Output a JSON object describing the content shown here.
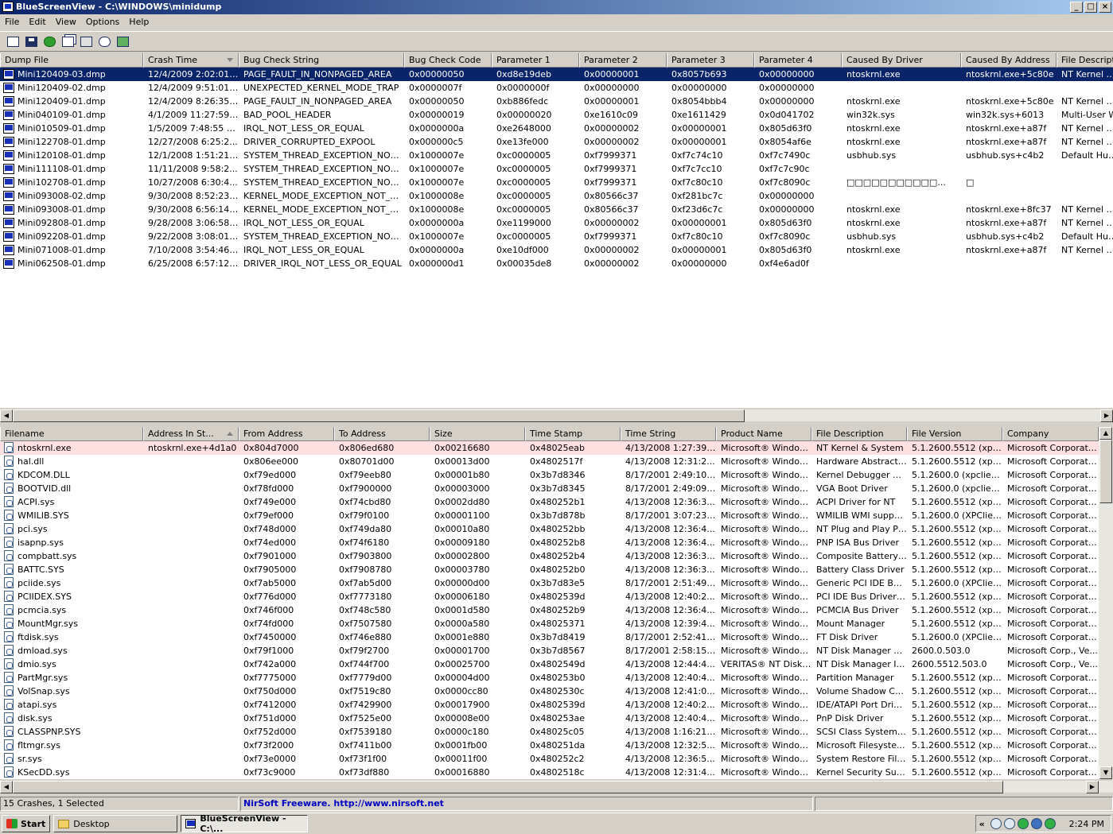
{
  "window": {
    "title": "BlueScreenView  -  C:\\WINDOWS\\minidump",
    "min": "_",
    "max": "□",
    "close": "×"
  },
  "menu": [
    "File",
    "Edit",
    "View",
    "Options",
    "Help"
  ],
  "toolbar": [
    "properties-list-icon",
    "save-icon",
    "refresh-icon",
    "copy-icon",
    "properties-icon",
    "find-icon",
    "exit-icon"
  ],
  "crash_table": {
    "columns": [
      "Dump File",
      "Crash Time",
      "Bug Check String",
      "Bug Check Code",
      "Parameter 1",
      "Parameter 2",
      "Parameter 3",
      "Parameter 4",
      "Caused By Driver",
      "Caused By Address",
      "File Descripti"
    ],
    "rows": [
      [
        "Mini120409-03.dmp",
        "12/4/2009 2:02:01 PM",
        "PAGE_FAULT_IN_NONPAGED_AREA",
        "0x00000050",
        "0xd8e19deb",
        "0x00000001",
        "0x8057b693",
        "0x00000000",
        "ntoskrnl.exe",
        "ntoskrnl.exe+5c80e",
        "NT Kernel & S"
      ],
      [
        "Mini120409-02.dmp",
        "12/4/2009 9:51:01 ...",
        "UNEXPECTED_KERNEL_MODE_TRAP",
        "0x0000007f",
        "0x0000000f",
        "0x00000000",
        "0x00000000",
        "0x00000000",
        "",
        "",
        ""
      ],
      [
        "Mini120409-01.dmp",
        "12/4/2009 8:26:35 ...",
        "PAGE_FAULT_IN_NONPAGED_AREA",
        "0x00000050",
        "0xb886fedc",
        "0x00000001",
        "0x8054bbb4",
        "0x00000000",
        "ntoskrnl.exe",
        "ntoskrnl.exe+5c80e",
        "NT Kernel & S"
      ],
      [
        "Mini040109-01.dmp",
        "4/1/2009 11:27:59 ...",
        "BAD_POOL_HEADER",
        "0x00000019",
        "0x00000020",
        "0xe1610c09",
        "0xe1611429",
        "0x0d041702",
        "win32k.sys",
        "win32k.sys+6013",
        "Multi-User W"
      ],
      [
        "Mini010509-01.dmp",
        "1/5/2009 7:48:55 AM",
        "IRQL_NOT_LESS_OR_EQUAL",
        "0x0000000a",
        "0xe2648000",
        "0x00000002",
        "0x00000001",
        "0x805d63f0",
        "ntoskrnl.exe",
        "ntoskrnl.exe+a87f",
        "NT Kernel & S"
      ],
      [
        "Mini122708-01.dmp",
        "12/27/2008 6:25:2...",
        "DRIVER_CORRUPTED_EXPOOL",
        "0x000000c5",
        "0xe13fe000",
        "0x00000002",
        "0x00000001",
        "0x8054af6e",
        "ntoskrnl.exe",
        "ntoskrnl.exe+a87f",
        "NT Kernel & S"
      ],
      [
        "Mini120108-01.dmp",
        "12/1/2008 1:51:21 PM",
        "SYSTEM_THREAD_EXCEPTION_NOT_...",
        "0x1000007e",
        "0xc0000005",
        "0xf7999371",
        "0xf7c74c10",
        "0xf7c7490c",
        "usbhub.sys",
        "usbhub.sys+c4b2",
        "Default Hub D"
      ],
      [
        "Mini111108-01.dmp",
        "11/11/2008 9:58:2...",
        "SYSTEM_THREAD_EXCEPTION_NOT_...",
        "0x1000007e",
        "0xc0000005",
        "0xf7999371",
        "0xf7c7cc10",
        "0xf7c7c90c",
        "",
        "",
        ""
      ],
      [
        "Mini102708-01.dmp",
        "10/27/2008 6:30:4...",
        "SYSTEM_THREAD_EXCEPTION_NOT_...",
        "0x1000007e",
        "0xc0000005",
        "0xf7999371",
        "0xf7c80c10",
        "0xf7c8090c",
        "□□□□□□□□□□□...",
        "□",
        ""
      ],
      [
        "Mini093008-02.dmp",
        "9/30/2008 8:52:23 ...",
        "KERNEL_MODE_EXCEPTION_NOT_HA...",
        "0x1000008e",
        "0xc0000005",
        "0x80566c37",
        "0xf281bc7c",
        "0x00000000",
        "",
        "",
        ""
      ],
      [
        "Mini093008-01.dmp",
        "9/30/2008 6:56:14 ...",
        "KERNEL_MODE_EXCEPTION_NOT_HA...",
        "0x1000008e",
        "0xc0000005",
        "0x80566c37",
        "0xf23d6c7c",
        "0x00000000",
        "ntoskrnl.exe",
        "ntoskrnl.exe+8fc37",
        "NT Kernel & S"
      ],
      [
        "Mini092808-01.dmp",
        "9/28/2008 3:06:58 PM",
        "IRQL_NOT_LESS_OR_EQUAL",
        "0x0000000a",
        "0xe1199000",
        "0x00000002",
        "0x00000001",
        "0x805d63f0",
        "ntoskrnl.exe",
        "ntoskrnl.exe+a87f",
        "NT Kernel & S"
      ],
      [
        "Mini092208-01.dmp",
        "9/22/2008 3:08:01 PM",
        "SYSTEM_THREAD_EXCEPTION_NOT_...",
        "0x1000007e",
        "0xc0000005",
        "0xf7999371",
        "0xf7c80c10",
        "0xf7c8090c",
        "usbhub.sys",
        "usbhub.sys+c4b2",
        "Default Hub D"
      ],
      [
        "Mini071008-01.dmp",
        "7/10/2008 3:54:46 PM",
        "IRQL_NOT_LESS_OR_EQUAL",
        "0x0000000a",
        "0xe10df000",
        "0x00000002",
        "0x00000001",
        "0x805d63f0",
        "ntoskrnl.exe",
        "ntoskrnl.exe+a87f",
        "NT Kernel & S"
      ],
      [
        "Mini062508-01.dmp",
        "6/25/2008 6:57:12 ...",
        "DRIVER_IRQL_NOT_LESS_OR_EQUAL",
        "0x000000d1",
        "0x00035de8",
        "0x00000002",
        "0x00000000",
        "0xf4e6ad0f",
        "",
        "",
        ""
      ]
    ]
  },
  "driver_table": {
    "columns": [
      "Filename",
      "Address In St...",
      "From Address",
      "To Address",
      "Size",
      "Time Stamp",
      "Time String",
      "Product Name",
      "File Description",
      "File Version",
      "Company"
    ],
    "rows": [
      [
        "ntoskrnl.exe",
        "ntoskrnl.exe+4d1a0",
        "0x804d7000",
        "0x806ed680",
        "0x00216680",
        "0x48025eab",
        "4/13/2008 1:27:39 PM",
        "Microsoft® Window...",
        "NT Kernel & System",
        "5.1.2600.5512 (xps...",
        "Microsoft Corporation"
      ],
      [
        "hal.dll",
        "",
        "0x806ee000",
        "0x80701d00",
        "0x00013d00",
        "0x4802517f",
        "4/13/2008 12:31:2...",
        "Microsoft® Window...",
        "Hardware Abstracti...",
        "5.1.2600.5512 (xps...",
        "Microsoft Corporation"
      ],
      [
        "KDCOM.DLL",
        "",
        "0xf79ed000",
        "0xf79eeb80",
        "0x00001b80",
        "0x3b7d8346",
        "8/17/2001 2:49:10 PM",
        "Microsoft® Window...",
        "Kernel Debugger H...",
        "5.1.2600.0 (xpclien...",
        "Microsoft Corporation"
      ],
      [
        "BOOTVID.dll",
        "",
        "0xf78fd000",
        "0xf7900000",
        "0x00003000",
        "0x3b7d8345",
        "8/17/2001 2:49:09 PM",
        "Microsoft® Window...",
        "VGA Boot Driver",
        "5.1.2600.0 (xpclien...",
        "Microsoft Corporation"
      ],
      [
        "ACPI.sys",
        "",
        "0xf749e000",
        "0xf74cbd80",
        "0x0002dd80",
        "0x480252b1",
        "4/13/2008 12:36:3...",
        "Microsoft® Window...",
        "ACPI Driver for NT",
        "5.1.2600.5512 (xps...",
        "Microsoft Corporation"
      ],
      [
        "WMILIB.SYS",
        "",
        "0xf79ef000",
        "0xf79f0100",
        "0x00001100",
        "0x3b7d878b",
        "8/17/2001 3:07:23 PM",
        "Microsoft® Window...",
        "WMILIB WMI suppo...",
        "5.1.2600.0 (XPClien...",
        "Microsoft Corporation"
      ],
      [
        "pci.sys",
        "",
        "0xf748d000",
        "0xf749da80",
        "0x00010a80",
        "0x480252bb",
        "4/13/2008 12:36:4...",
        "Microsoft® Window...",
        "NT Plug and Play PC...",
        "5.1.2600.5512 (xps...",
        "Microsoft Corporation"
      ],
      [
        "isapnp.sys",
        "",
        "0xf74ed000",
        "0xf74f6180",
        "0x00009180",
        "0x480252b8",
        "4/13/2008 12:36:4...",
        "Microsoft® Window...",
        "PNP ISA Bus Driver",
        "5.1.2600.5512 (xps...",
        "Microsoft Corporation"
      ],
      [
        "compbatt.sys",
        "",
        "0xf7901000",
        "0xf7903800",
        "0x00002800",
        "0x480252b4",
        "4/13/2008 12:36:3...",
        "Microsoft® Window...",
        "Composite Battery ...",
        "5.1.2600.5512 (xps...",
        "Microsoft Corporation"
      ],
      [
        "BATTC.SYS",
        "",
        "0xf7905000",
        "0xf7908780",
        "0x00003780",
        "0x480252b0",
        "4/13/2008 12:36:3...",
        "Microsoft® Window...",
        "Battery Class Driver",
        "5.1.2600.5512 (xps...",
        "Microsoft Corporation"
      ],
      [
        "pciide.sys",
        "",
        "0xf7ab5000",
        "0xf7ab5d00",
        "0x00000d00",
        "0x3b7d83e5",
        "8/17/2001 2:51:49 PM",
        "Microsoft® Window...",
        "Generic PCI IDE Bus...",
        "5.1.2600.0 (XPClien...",
        "Microsoft Corporation"
      ],
      [
        "PCIIDEX.SYS",
        "",
        "0xf776d000",
        "0xf7773180",
        "0x00006180",
        "0x4802539d",
        "4/13/2008 12:40:2...",
        "Microsoft® Window...",
        "PCI IDE Bus Driver ...",
        "5.1.2600.5512 (xps...",
        "Microsoft Corporation"
      ],
      [
        "pcmcia.sys",
        "",
        "0xf746f000",
        "0xf748c580",
        "0x0001d580",
        "0x480252b9",
        "4/13/2008 12:36:4...",
        "Microsoft® Window...",
        "PCMCIA Bus Driver",
        "5.1.2600.5512 (xps...",
        "Microsoft Corporation"
      ],
      [
        "MountMgr.sys",
        "",
        "0xf74fd000",
        "0xf7507580",
        "0x0000a580",
        "0x48025371",
        "4/13/2008 12:39:4...",
        "Microsoft® Window...",
        "Mount Manager",
        "5.1.2600.5512 (xps...",
        "Microsoft Corporation"
      ],
      [
        "ftdisk.sys",
        "",
        "0xf7450000",
        "0xf746e880",
        "0x0001e880",
        "0x3b7d8419",
        "8/17/2001 2:52:41 PM",
        "Microsoft® Window...",
        "FT Disk Driver",
        "5.1.2600.0 (XPClien...",
        "Microsoft Corporation"
      ],
      [
        "dmload.sys",
        "",
        "0xf79f1000",
        "0xf79f2700",
        "0x00001700",
        "0x3b7d8567",
        "8/17/2001 2:58:15 PM",
        "Microsoft® Window...",
        "NT Disk Manager St...",
        "2600.0.503.0",
        "Microsoft Corp., Ve..."
      ],
      [
        "dmio.sys",
        "",
        "0xf742a000",
        "0xf744f700",
        "0x00025700",
        "0x4802549d",
        "4/13/2008 12:44:4...",
        "VERITAS® NT Disk ...",
        "NT Disk Manager I/...",
        "2600.5512.503.0",
        "Microsoft Corp., Ve..."
      ],
      [
        "PartMgr.sys",
        "",
        "0xf7775000",
        "0xf7779d00",
        "0x00004d00",
        "0x480253b0",
        "4/13/2008 12:40:4...",
        "Microsoft® Window...",
        "Partition Manager",
        "5.1.2600.5512 (xps...",
        "Microsoft Corporation"
      ],
      [
        "VolSnap.sys",
        "",
        "0xf750d000",
        "0xf7519c80",
        "0x0000cc80",
        "0x4802530c",
        "4/13/2008 12:41:0...",
        "Microsoft® Window...",
        "Volume Shadow Co...",
        "5.1.2600.5512 (xps...",
        "Microsoft Corporation"
      ],
      [
        "atapi.sys",
        "",
        "0xf7412000",
        "0xf7429900",
        "0x00017900",
        "0x4802539d",
        "4/13/2008 12:40:2...",
        "Microsoft® Window...",
        "IDE/ATAPI Port Driver",
        "5.1.2600.5512 (xps...",
        "Microsoft Corporation"
      ],
      [
        "disk.sys",
        "",
        "0xf751d000",
        "0xf7525e00",
        "0x00008e00",
        "0x480253ae",
        "4/13/2008 12:40:4...",
        "Microsoft® Window...",
        "PnP Disk Driver",
        "5.1.2600.5512 (xps...",
        "Microsoft Corporation"
      ],
      [
        "CLASSPNP.SYS",
        "",
        "0xf752d000",
        "0xf7539180",
        "0x0000c180",
        "0x48025c05",
        "4/13/2008 1:16:21 PM",
        "Microsoft® Window...",
        "SCSI Class System Dll",
        "5.1.2600.5512 (xps...",
        "Microsoft Corporation"
      ],
      [
        "fltmgr.sys",
        "",
        "0xf73f2000",
        "0xf7411b00",
        "0x0001fb00",
        "0x480251da",
        "4/13/2008 12:32:5...",
        "Microsoft® Window...",
        "Microsoft Filesyste...",
        "5.1.2600.5512 (xps...",
        "Microsoft Corporation"
      ],
      [
        "sr.sys",
        "",
        "0xf73e0000",
        "0xf73f1f00",
        "0x00011f00",
        "0x480252c2",
        "4/13/2008 12:36:5...",
        "Microsoft® Window...",
        "System Restore File...",
        "5.1.2600.5512 (xps...",
        "Microsoft Corporation"
      ],
      [
        "KSecDD.sys",
        "",
        "0xf73c9000",
        "0xf73df880",
        "0x00016880",
        "0x4802518c",
        "4/13/2008 12:31:4...",
        "Microsoft® Window...",
        "Kernel Security Sup...",
        "5.1.2600.5512 (xps...",
        "Microsoft Corporation"
      ]
    ]
  },
  "status": {
    "count": "15 Crashes, 1 Selected",
    "freeware": "NirSoft Freeware.  http://www.nirsoft.net"
  },
  "taskbar": {
    "start": "Start",
    "items": [
      "Desktop",
      "BlueScreenView  -  C:\\..."
    ],
    "chevron": "«",
    "clock": "2:24 PM"
  },
  "colors": {
    "selected_row": "#0a246a",
    "highlight_row": "#ffe0e0",
    "title_gradient_start": "#0a246a",
    "link": "#0000c0"
  }
}
